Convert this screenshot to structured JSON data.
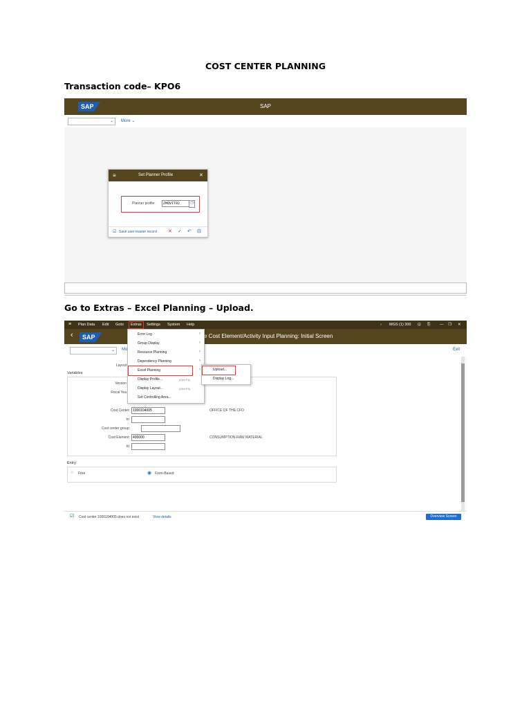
{
  "document": {
    "title": "COST CENTER PLANNING",
    "transaction_line": "Transaction code– KPO6",
    "instruction_line": "Go to Extras – Excel Planning – Upload."
  },
  "colors": {
    "sap_bar": "#55451f",
    "menu_bar": "#3e3217",
    "sap_blue": "#1a5fb4",
    "highlight_red": "#e53935",
    "link_blue": "#2060b0"
  },
  "screen1": {
    "logo": "SAP",
    "window_title": "SAP",
    "more_label": "More",
    "dialog": {
      "title": "Set Planner Profile",
      "menu_icon": "hamburger-icon",
      "close_icon": "close-icon",
      "field_label": "Planner profile:",
      "field_value": "ZMOVIT02",
      "save_checkbox_label": "Save user master record"
    }
  },
  "screen2": {
    "menu": [
      "Plan Data",
      "Edit",
      "Goto",
      "Extras",
      "Settings",
      "System",
      "Help"
    ],
    "system_info": "MGS (1) 300",
    "logo": "SAP",
    "screen_title": "e Cost Element/Activity Input Planning: Initial Screen",
    "more_label": "Mo",
    "exit_label": "Exit",
    "extras_menu": [
      {
        "label": "Error Log",
        "submenu": true
      },
      {
        "label": "Group Display",
        "submenu": true
      },
      {
        "label": "Resource Planning",
        "submenu": true
      },
      {
        "label": "Dependency Planning",
        "submenu": true
      },
      {
        "label": "Excel Planning",
        "submenu": true
      },
      {
        "label": "Display Profile...",
        "shortcut": "(Ctrl+F4)"
      },
      {
        "label": "Display Layout...",
        "shortcut": "(Ctrl+F3)"
      },
      {
        "label": "Set Controlling Area..."
      }
    ],
    "excel_submenu": [
      "Upload...",
      "Display Log..."
    ],
    "layout_label": "Layout",
    "variables_heading": "Variables",
    "version_label": "Version",
    "fiscal_year_label": "Fiscal Yea",
    "cost_center_label": "Cost Center:",
    "cost_center_value": "1000104005",
    "cost_center_desc": "OFFICE OF THE CFO",
    "to_label_1": "to:",
    "cost_center_group_label": "Cost center group:",
    "cost_element_label": "Cost Element:",
    "cost_element_value": "400000",
    "cost_element_desc": "CONSUMPTION-RAW MATERIAL",
    "to_label_2": "to:",
    "entry_heading": "Entry",
    "free_label": "Free",
    "form_based_label": "Form-Based",
    "status_message": "Cost center 1000104005 does not exist",
    "view_details": "View details",
    "overview_button": "Overview Screen"
  }
}
